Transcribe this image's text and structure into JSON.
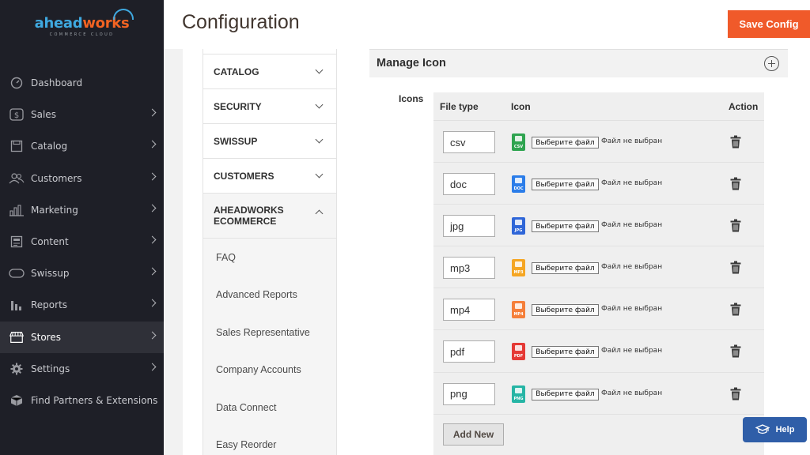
{
  "logo": {
    "part1": "ahead",
    "part2": "works",
    "sub": "COMMERCE CLOUD"
  },
  "sidebar": {
    "items": [
      {
        "label": "Dashboard",
        "icon": "dashboard-icon"
      },
      {
        "label": "Sales",
        "icon": "dollar-icon"
      },
      {
        "label": "Catalog",
        "icon": "catalog-icon"
      },
      {
        "label": "Customers",
        "icon": "customers-icon"
      },
      {
        "label": "Marketing",
        "icon": "marketing-icon"
      },
      {
        "label": "Content",
        "icon": "content-icon"
      },
      {
        "label": "Swissup",
        "icon": "swissup-icon"
      },
      {
        "label": "Reports",
        "icon": "reports-icon"
      },
      {
        "label": "Stores",
        "icon": "stores-icon"
      },
      {
        "label": "Settings",
        "icon": "settings-icon"
      },
      {
        "label": "Find Partners & Extensions",
        "icon": "extensions-icon"
      }
    ],
    "active": "Stores"
  },
  "header": {
    "title": "Configuration",
    "save_label": "Save Config"
  },
  "tabs": {
    "items": [
      {
        "label": "CATALOG"
      },
      {
        "label": "SECURITY"
      },
      {
        "label": "SWISSUP"
      },
      {
        "label": "CUSTOMERS"
      },
      {
        "label": "AHEADWORKS ECOMMERCE"
      }
    ],
    "subitems": [
      {
        "label": "FAQ"
      },
      {
        "label": "Advanced Reports"
      },
      {
        "label": "Sales Representative"
      },
      {
        "label": "Company Accounts"
      },
      {
        "label": "Data Connect"
      },
      {
        "label": "Easy Reorder"
      }
    ]
  },
  "section": {
    "title": "Manage Icon"
  },
  "icons_table": {
    "field_label": "Icons",
    "headers": {
      "file_type": "File type",
      "icon": "Icon",
      "action": "Action"
    },
    "choose_label": "Выберите файл",
    "no_file_label": "Файл не выбран",
    "rows": [
      {
        "type": "csv",
        "ext": "CSV",
        "color": "#2ea44f"
      },
      {
        "type": "doc",
        "ext": "DOC",
        "color": "#2b7de9"
      },
      {
        "type": "jpg",
        "ext": "JPG",
        "color": "#2f66d8"
      },
      {
        "type": "mp3",
        "ext": "MP3",
        "color": "#f5a623"
      },
      {
        "type": "mp4",
        "ext": "MP4",
        "color": "#f57f3a"
      },
      {
        "type": "pdf",
        "ext": "PDF",
        "color": "#e53935"
      },
      {
        "type": "png",
        "ext": "PNG",
        "color": "#26b5a5"
      }
    ],
    "add_label": "Add New"
  },
  "help": {
    "label": "Help"
  },
  "colors": {
    "sidebar_bg": "#1e1f27",
    "accent": "#f05a2a",
    "help_bg": "#2f5ea8"
  }
}
